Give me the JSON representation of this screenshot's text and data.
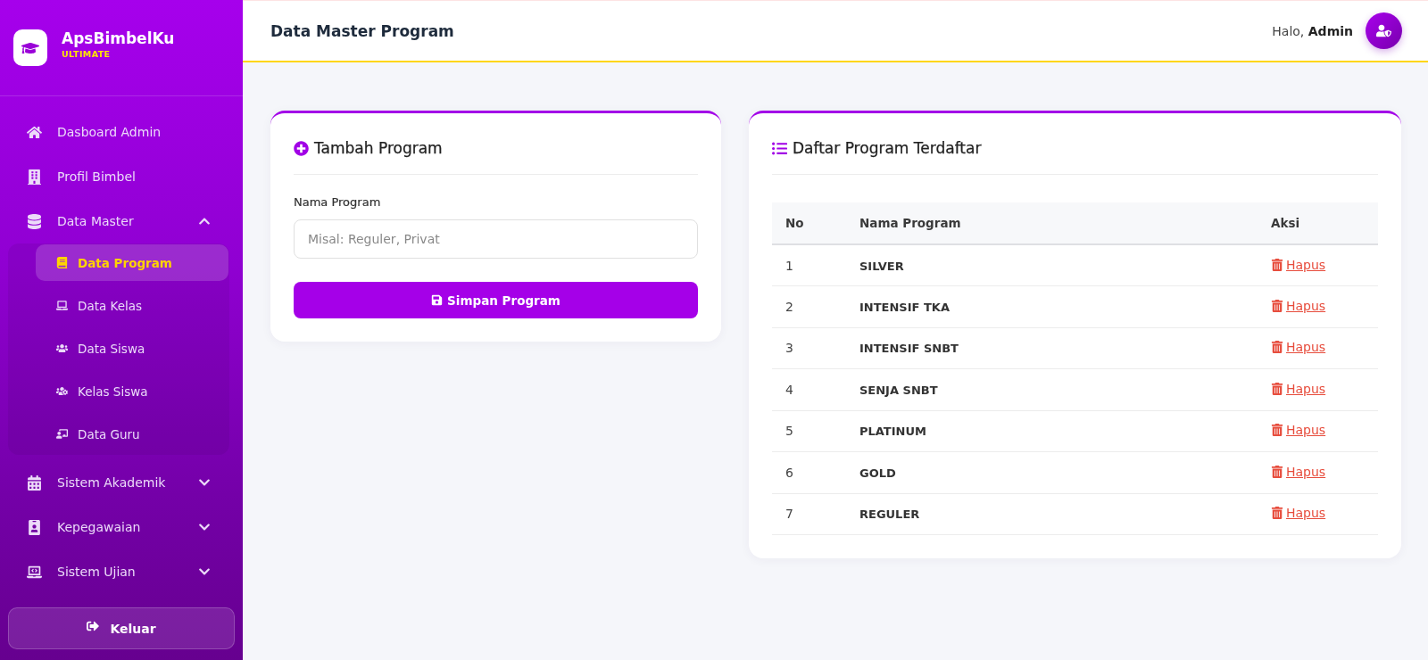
{
  "sidebar": {
    "brand": {
      "name": "ApsBimbelKu",
      "edition": "ULTIMATE"
    },
    "menu": [
      {
        "kind": "link",
        "label": "Dasboard Admin",
        "selected": false
      },
      {
        "kind": "link",
        "label": "Profil Bimbel",
        "selected": false
      },
      {
        "kind": "group",
        "label": "Data Master",
        "expanded": true,
        "children": [
          {
            "label": "Data Program",
            "selected": true
          },
          {
            "label": "Data Kelas",
            "selected": false
          },
          {
            "label": "Data Siswa",
            "selected": false
          },
          {
            "label": "Kelas Siswa",
            "selected": false
          },
          {
            "label": "Data Guru",
            "selected": false
          }
        ]
      },
      {
        "kind": "group",
        "label": "Sistem Akademik",
        "expanded": false
      },
      {
        "kind": "group",
        "label": "Kepegawaian",
        "expanded": false
      },
      {
        "kind": "group",
        "label": "Sistem Ujian",
        "expanded": false
      }
    ],
    "logout": "Keluar"
  },
  "header": {
    "title": "Data Master Program",
    "greeting": "Halo, **Admin**"
  },
  "form_card": {
    "title": "Tambah Program",
    "field": {
      "label": "Nama Program",
      "placeholder": "Misal: Reguler, Privat"
    },
    "submit": "Simpan Program"
  },
  "table_card": {
    "title": "Daftar Program Terdaftar",
    "columns": [
      "No",
      "Nama Program",
      "Aksi"
    ],
    "rows": [
      {
        "no": "1",
        "name": "SILVER",
        "action": "Hapus"
      },
      {
        "no": "2",
        "name": "INTENSIF TKA",
        "action": "Hapus"
      },
      {
        "no": "3",
        "name": "INTENSIF SNBT",
        "action": "Hapus"
      },
      {
        "no": "4",
        "name": "SENJA SNBT",
        "action": "Hapus"
      },
      {
        "no": "5",
        "name": "PLATINUM",
        "action": "Hapus"
      },
      {
        "no": "6",
        "name": "GOLD",
        "action": "Hapus"
      },
      {
        "no": "7",
        "name": "REGULER",
        "action": "Hapus"
      }
    ]
  }
}
